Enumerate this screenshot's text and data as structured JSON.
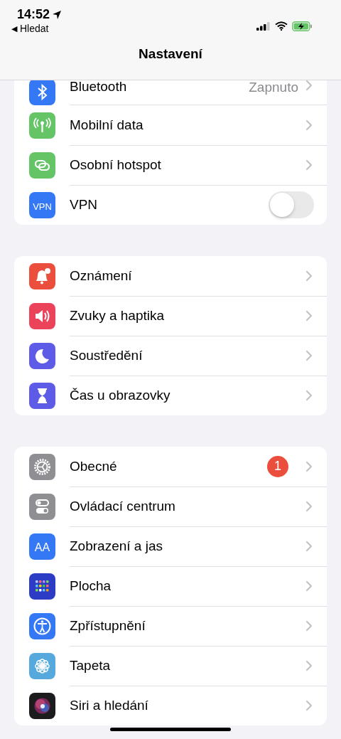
{
  "status_bar": {
    "time": "14:52",
    "back_arrow": "◀",
    "back_label": "Hledat"
  },
  "nav": {
    "title": "Nastavení"
  },
  "groups": [
    {
      "rows": [
        {
          "kind": "chevron",
          "label": "Bluetooth",
          "value": "Zapnuto"
        },
        {
          "kind": "chevron",
          "label": "Mobilní data"
        },
        {
          "kind": "chevron",
          "label": "Osobní hotspot"
        },
        {
          "kind": "toggle",
          "label": "VPN",
          "icon_text": "VPN",
          "on": false
        }
      ]
    },
    {
      "rows": [
        {
          "kind": "chevron",
          "label": "Oznámení"
        },
        {
          "kind": "chevron",
          "label": "Zvuky a haptika"
        },
        {
          "kind": "chevron",
          "label": "Soustředění"
        },
        {
          "kind": "chevron",
          "label": "Čas u obrazovky"
        }
      ]
    },
    {
      "rows": [
        {
          "kind": "chevron",
          "label": "Obecné",
          "badge": "1"
        },
        {
          "kind": "chevron",
          "label": "Ovládací centrum"
        },
        {
          "kind": "chevron",
          "label": "Zobrazení a jas",
          "icon_text": "AA"
        },
        {
          "kind": "chevron",
          "label": "Plocha"
        },
        {
          "kind": "chevron",
          "label": "Zpřístupnění"
        },
        {
          "kind": "chevron",
          "label": "Tapeta"
        },
        {
          "kind": "chevron",
          "label": "Siri a hledání"
        }
      ]
    }
  ]
}
